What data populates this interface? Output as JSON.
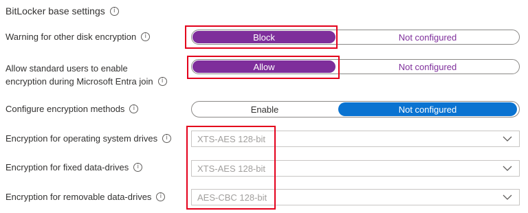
{
  "section": {
    "title": "BitLocker base settings",
    "info_glyph": "i"
  },
  "settings": [
    {
      "label": "Warning for other disk encryption",
      "options": [
        "Block",
        "Not configured"
      ],
      "selected": "Block"
    },
    {
      "label_line1": "Allow standard users to enable",
      "label_line2": "encryption during Microsoft Entra join",
      "options": [
        "Allow",
        "Not configured"
      ],
      "selected": "Allow"
    },
    {
      "label": "Configure encryption methods",
      "options": [
        "Enable",
        "Not configured"
      ],
      "selected": "Not configured"
    }
  ],
  "dropdowns": [
    {
      "label": "Encryption for operating system drives",
      "value": "XTS-AES 128-bit",
      "icon": "chevron-down-icon"
    },
    {
      "label": "Encryption for fixed data-drives",
      "value": "XTS-AES 128-bit",
      "icon": "chevron-down-icon"
    },
    {
      "label": "Encryption for removable data-drives",
      "value": "AES-CBC 128-bit",
      "icon": "chevron-down-icon"
    }
  ],
  "colors": {
    "accent_purple": "#7e2e9b",
    "accent_blue": "#0a73d1",
    "highlight_red": "#e3001b"
  }
}
